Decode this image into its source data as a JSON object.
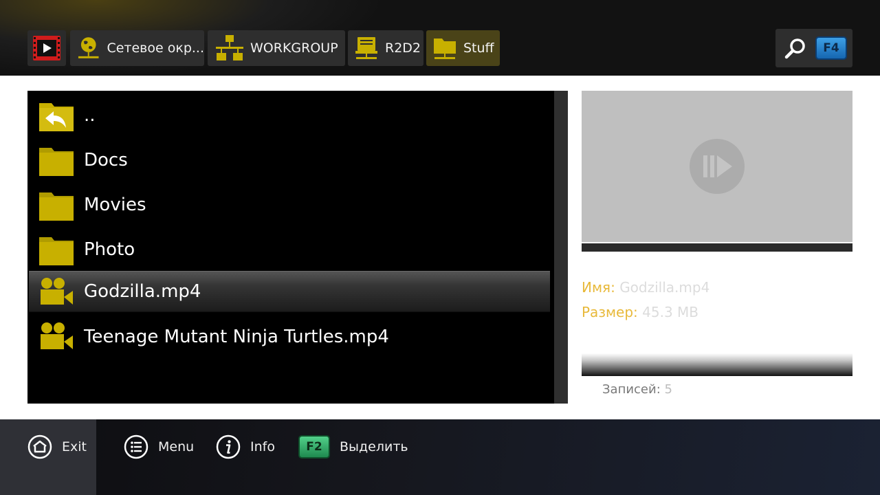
{
  "breadcrumbs": [
    {
      "label": ""
    },
    {
      "label": "Сетевое окр..."
    },
    {
      "label": "WORKGROUP"
    },
    {
      "label": "R2D2"
    },
    {
      "label": "Stuff"
    }
  ],
  "search": {
    "key": "F4"
  },
  "files": [
    {
      "name": "..",
      "icon": "folder-up-icon"
    },
    {
      "name": "Docs",
      "icon": "folder-icon"
    },
    {
      "name": "Movies",
      "icon": "folder-icon"
    },
    {
      "name": "Photo",
      "icon": "folder-icon"
    },
    {
      "name": "Godzilla.mp4",
      "icon": "video-camera-icon",
      "selected": true
    },
    {
      "name": "Teenage Mutant Ninja Turtles.mp4",
      "icon": "video-camera-icon"
    }
  ],
  "details": {
    "name_label": "Имя:",
    "name_value": "Godzilla.mp4",
    "size_label": "Размер:",
    "size_value": "45.3 MB",
    "records_label": "Записей:",
    "records_value": "5"
  },
  "footer": {
    "exit_label": "Exit",
    "menu_label": "Menu",
    "info_label": "Info",
    "select_key": "F2",
    "select_label": "Выделить"
  },
  "colors": {
    "accent_yellow": "#e8b93a",
    "folder_yellow": "#c8b000",
    "selected_row": "#353535",
    "f4_key": "#2a86d2",
    "f2_key": "#3ab06e"
  }
}
